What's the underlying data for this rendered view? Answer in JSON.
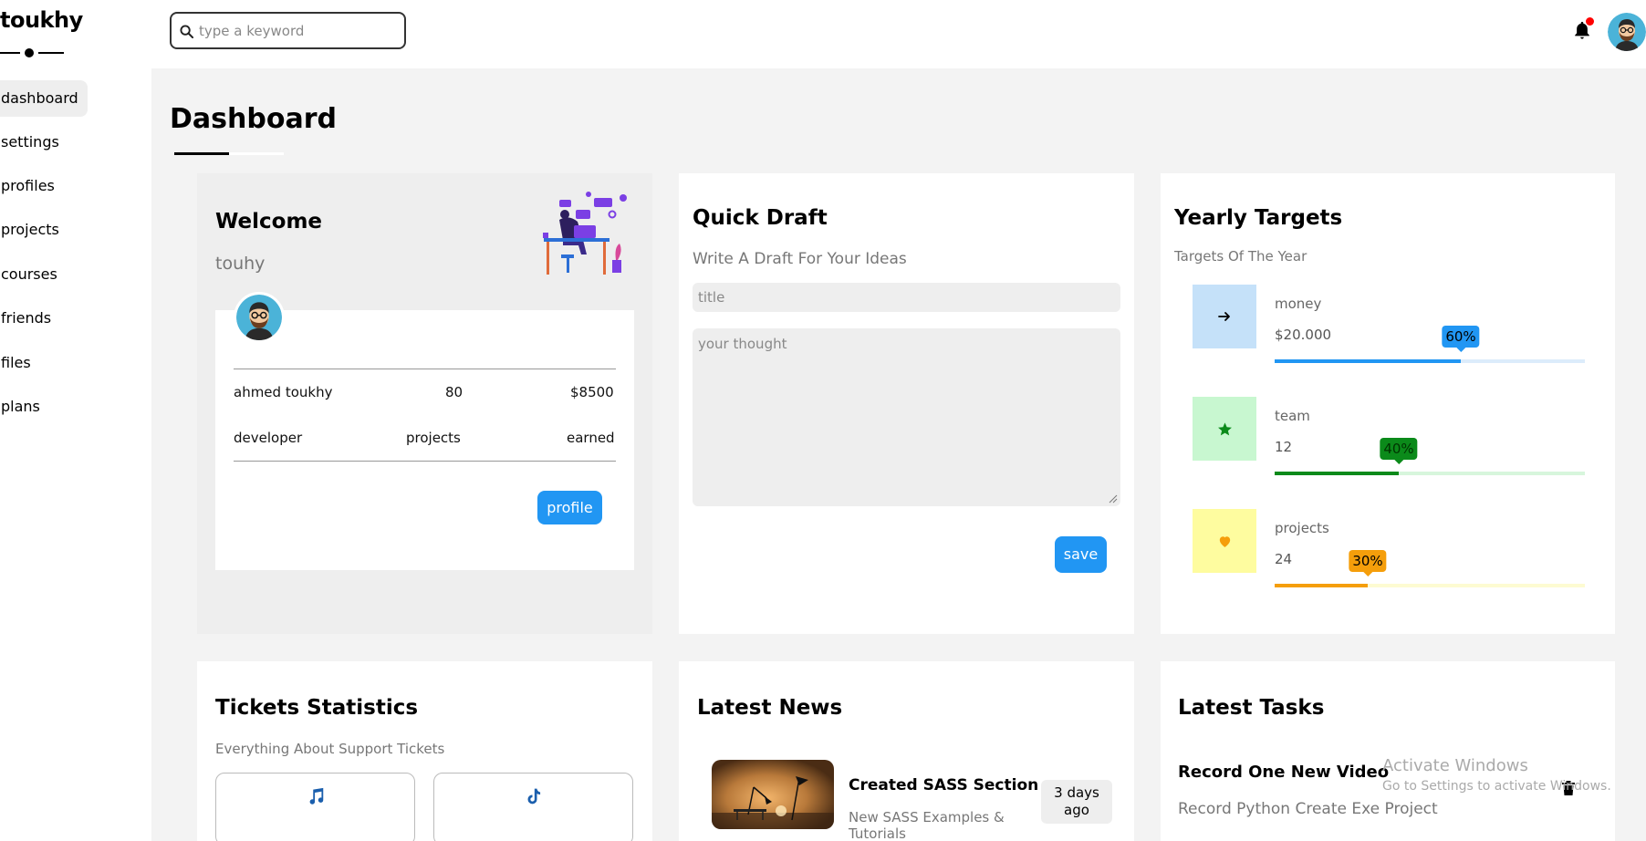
{
  "brand": {
    "name": "toukhy"
  },
  "sidebar": {
    "items": [
      {
        "label": "dashboard",
        "active": true
      },
      {
        "label": "settings"
      },
      {
        "label": "profiles"
      },
      {
        "label": "projects"
      },
      {
        "label": "courses"
      },
      {
        "label": "friends"
      },
      {
        "label": "files"
      },
      {
        "label": "plans"
      }
    ]
  },
  "header": {
    "search_placeholder": "type a keyword",
    "notification_badge_color": "#ff0000"
  },
  "page": {
    "title": "Dashboard"
  },
  "welcome": {
    "title": "Welcome",
    "username": "touhy",
    "stats": {
      "name": "ahmed toukhy",
      "role": "developer",
      "projects_value": "80",
      "projects_label": "projects",
      "earned_value": "$8500",
      "earned_label": "earned"
    },
    "profile_button": "profile"
  },
  "draft": {
    "title": "Quick Draft",
    "subtitle": "Write A Draft For Your Ideas",
    "title_placeholder": "title",
    "thought_placeholder": "your thought",
    "save_button": "save"
  },
  "targets": {
    "title": "Yearly Targets",
    "subtitle": "Targets Of The Year",
    "items": [
      {
        "name": "money",
        "value": "$20.000",
        "percent_label": "60%",
        "percent": 60,
        "icon": "arrow-right-icon",
        "icon_bg": "#c5e1f9",
        "color": "#2196f3",
        "track": "#dcecfb",
        "tip_text": "#000000"
      },
      {
        "name": "team",
        "value": "12",
        "percent_label": "40%",
        "percent": 40,
        "icon": "star-icon",
        "icon_bg": "#c8f7d0",
        "color": "#0b8a1a",
        "track": "#d7f6dc",
        "tip_text": "#003300"
      },
      {
        "name": "projects",
        "value": "24",
        "percent_label": "30%",
        "percent": 30,
        "icon": "heart-icon",
        "icon_bg": "#fefc9f",
        "color": "#f59e0b",
        "track": "#fdfbd2",
        "tip_text": "#000000"
      }
    ]
  },
  "tickets": {
    "title": "Tickets Statistics",
    "subtitle": "Everything About Support Tickets"
  },
  "news": {
    "title": "Latest News",
    "item_title": "Created SASS Section",
    "item_desc": "New SASS Examples & Tutorials",
    "item_date": "3 days ago"
  },
  "tasks": {
    "title": "Latest Tasks",
    "task_title": "Record One New Video",
    "task_desc": "Record Python Create Exe Project"
  },
  "watermark": {
    "line1": "Activate Windows",
    "line2": "Go to Settings to activate Windows."
  }
}
